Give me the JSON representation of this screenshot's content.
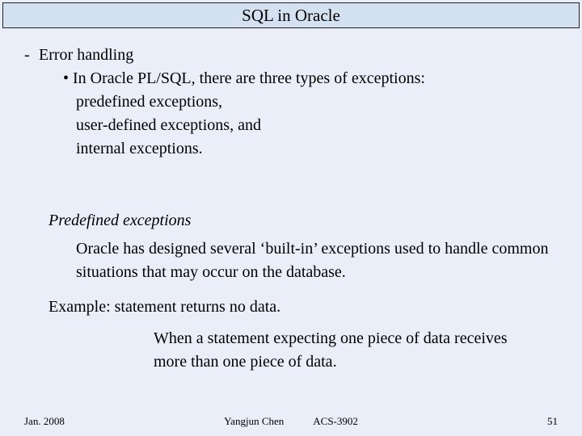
{
  "title": "SQL in Oracle",
  "body": {
    "dash": "-",
    "heading": "Error handling",
    "bullet": "• In Oracle PL/SQL, there are three types of exceptions:",
    "line1": "predefined exceptions,",
    "line2": "user-defined exceptions, and",
    "line3": "internal exceptions.",
    "section": "Predefined exceptions",
    "para1": "Oracle has designed several ‘built-in’ exceptions used to handle common situations that may occur on the database.",
    "example": "Example: statement returns no data.",
    "para2": "When a statement expecting one piece of data receives more than one piece of data."
  },
  "footer": {
    "date": "Jan. 2008",
    "author": "Yangjun Chen",
    "course": "ACS-3902",
    "page": "51"
  }
}
